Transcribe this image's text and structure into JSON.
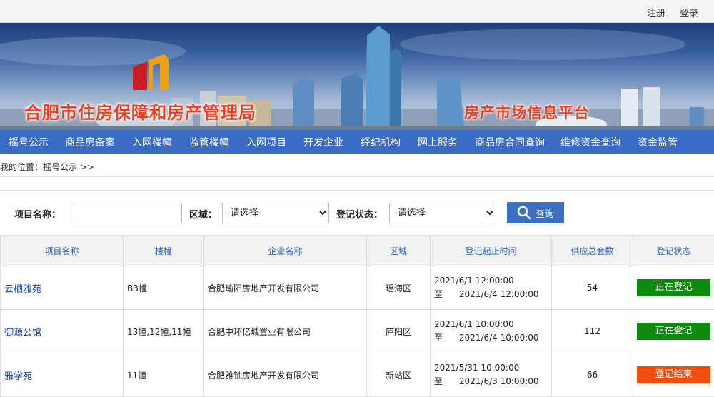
{
  "topbar": {
    "register": "注册",
    "login": "登录"
  },
  "banner": {
    "org_name": "合肥市住房保障和房产管理局",
    "platform_name": "房产市场信息平台"
  },
  "nav": [
    "摇号公示",
    "商品房备案",
    "入网楼幢",
    "监管楼幢",
    "入网项目",
    "开发企业",
    "经纪机构",
    "网上服务",
    "商品房合同查询",
    "维修资金查询",
    "资金监管"
  ],
  "breadcrumb": "我的位置：摇号公示 >>",
  "search": {
    "project_label": "项目名称：",
    "project_value": "",
    "district_label": "区域：",
    "district_selected": "-请选择-",
    "status_label": "登记状态：",
    "status_selected": "-请选择-",
    "query_button": "查询"
  },
  "table": {
    "headers": [
      "项目名称",
      "楼幢",
      "企业名称",
      "区域",
      "登记起止时间",
      "供应总套数",
      "登记状态"
    ],
    "time_to_prefix": "至",
    "rows": [
      {
        "name": "云栖雅苑",
        "buildings": "B3幢",
        "company": "合肥瑜阳房地产开发有限公司",
        "district": "瑶海区",
        "start": "2021/6/1 12:00:00",
        "end": "2021/6/4 12:00:00",
        "units": "54",
        "status": "正在登记",
        "status_color": "#0d8a0d"
      },
      {
        "name": "御源公馆",
        "buildings": "13幢,12幢,11幢",
        "company": "合肥中环亿城置业有限公司",
        "district": "庐阳区",
        "start": "2021/6/1 10:00:00",
        "end": "2021/6/4 10:00:00",
        "units": "112",
        "status": "正在登记",
        "status_color": "#0d8a0d"
      },
      {
        "name": "雅学苑",
        "buildings": "11幢",
        "company": "合肥雅铀房地产开发有限公司",
        "district": "新站区",
        "start": "2021/5/31 10:00:00",
        "end": "2021/6/3 10:00:00",
        "units": "66",
        "status": "登记结束",
        "status_color": "#f24e0f"
      }
    ]
  }
}
